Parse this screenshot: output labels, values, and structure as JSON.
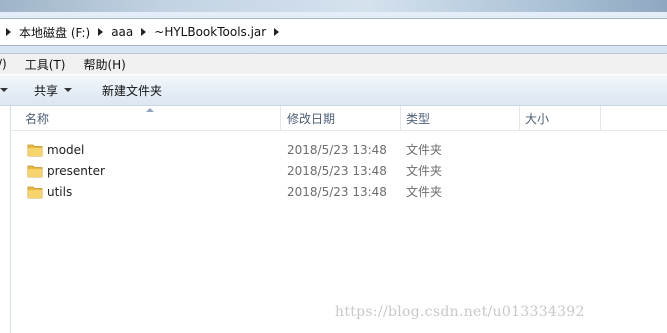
{
  "address": {
    "crumbs": [
      "本地磁盘 (F:)",
      "aaa",
      "~HYLBookTools.jar"
    ]
  },
  "menu": {
    "partial": "/)",
    "tools": "工具(T)",
    "help": "帮助(H)"
  },
  "toolbar": {
    "share": "共享",
    "new_folder": "新建文件夹"
  },
  "columns": {
    "name": "名称",
    "modified": "修改日期",
    "type": "类型",
    "size": "大小"
  },
  "files": [
    {
      "name": "model",
      "modified": "2018/5/23 13:48",
      "type": "文件夹",
      "size": ""
    },
    {
      "name": "presenter",
      "modified": "2018/5/23 13:48",
      "type": "文件夹",
      "size": ""
    },
    {
      "name": "utils",
      "modified": "2018/5/23 13:48",
      "type": "文件夹",
      "size": ""
    }
  ],
  "watermark": "https://blog.csdn.net/u013334392",
  "colors": {
    "folder": "#e8b83d",
    "header_text": "#4c607a"
  }
}
